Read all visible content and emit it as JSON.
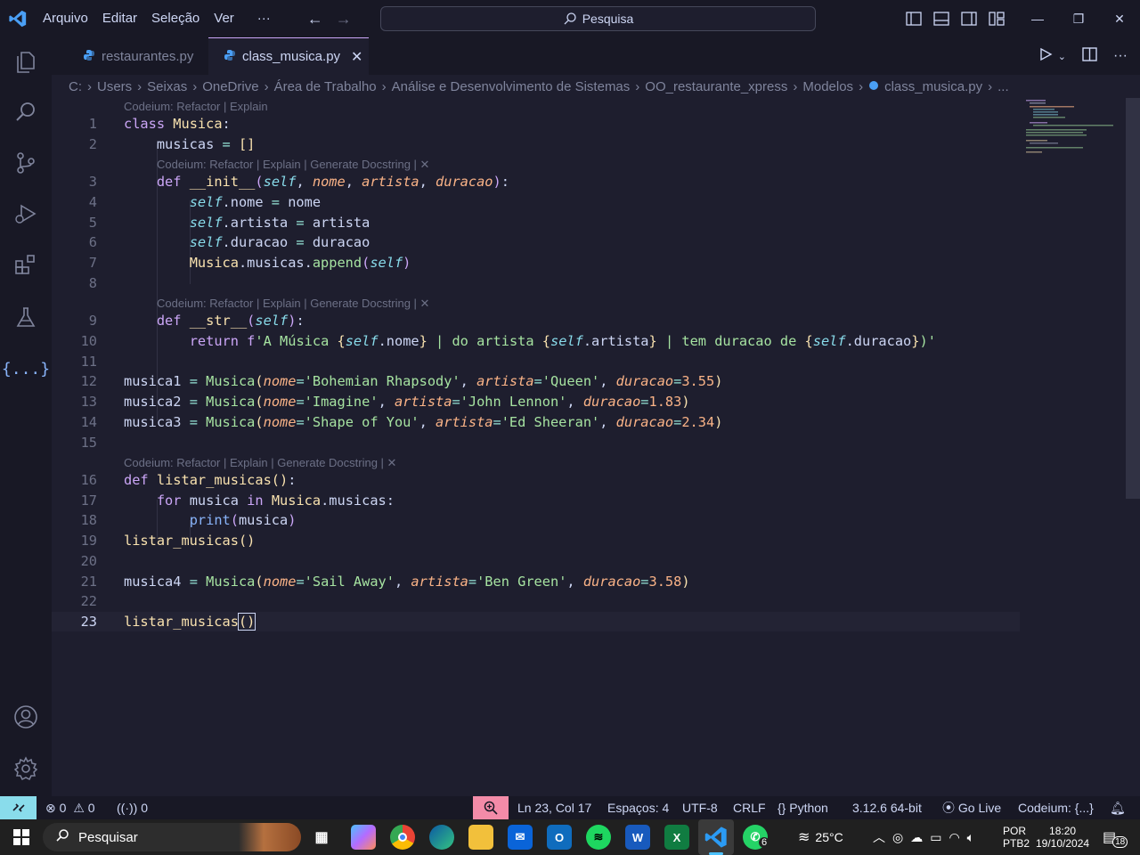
{
  "titlebar": {
    "menus": [
      "Arquivo",
      "Editar",
      "Seleção",
      "Ver",
      "···"
    ],
    "search_placeholder": "Pesquisa"
  },
  "tabs": [
    {
      "label": "restaurantes.py",
      "active": false
    },
    {
      "label": "class_musica.py",
      "active": true
    }
  ],
  "breadcrumb": [
    "C:",
    "Users",
    "Seixas",
    "OneDrive",
    "Área de Trabalho",
    "Análise e Desenvolvimento de Sistemas",
    "OO_restaurante_xpress",
    "Modelos",
    "class_musica.py",
    "..."
  ],
  "codelens": {
    "short": "Codeium: Refactor | Explain",
    "long": "Codeium: Refactor | Explain | Generate Docstring | ✕"
  },
  "line_numbers": [
    "1",
    "2",
    "3",
    "4",
    "5",
    "6",
    "7",
    "8",
    "9",
    "10",
    "11",
    "12",
    "13",
    "14",
    "15",
    "16",
    "17",
    "18",
    "19",
    "20",
    "21",
    "22",
    "23"
  ],
  "status": {
    "errors": "0",
    "warnings": "0",
    "ports": "0",
    "position": "Ln 23, Col 17",
    "spaces": "Espaços: 4",
    "encoding": "UTF-8",
    "eol": "CRLF",
    "language": "Python",
    "interpreter": "3.12.6 64-bit",
    "golive": "Go Live",
    "codeium": "Codeium: {...}"
  },
  "taskbar": {
    "search_placeholder": "Pesquisar",
    "whatsapp_badge": "6",
    "temperature": "25°C",
    "language": "POR",
    "layout": "PTB2",
    "time": "18:20",
    "date": "19/10/2024",
    "notifications": "18"
  },
  "colors": {
    "editor_bg": "#1e1e2e",
    "chrome_bg": "#181825",
    "accent": "#cba6f7",
    "remote": "#89dceb",
    "zoom": "#f38ba8"
  }
}
